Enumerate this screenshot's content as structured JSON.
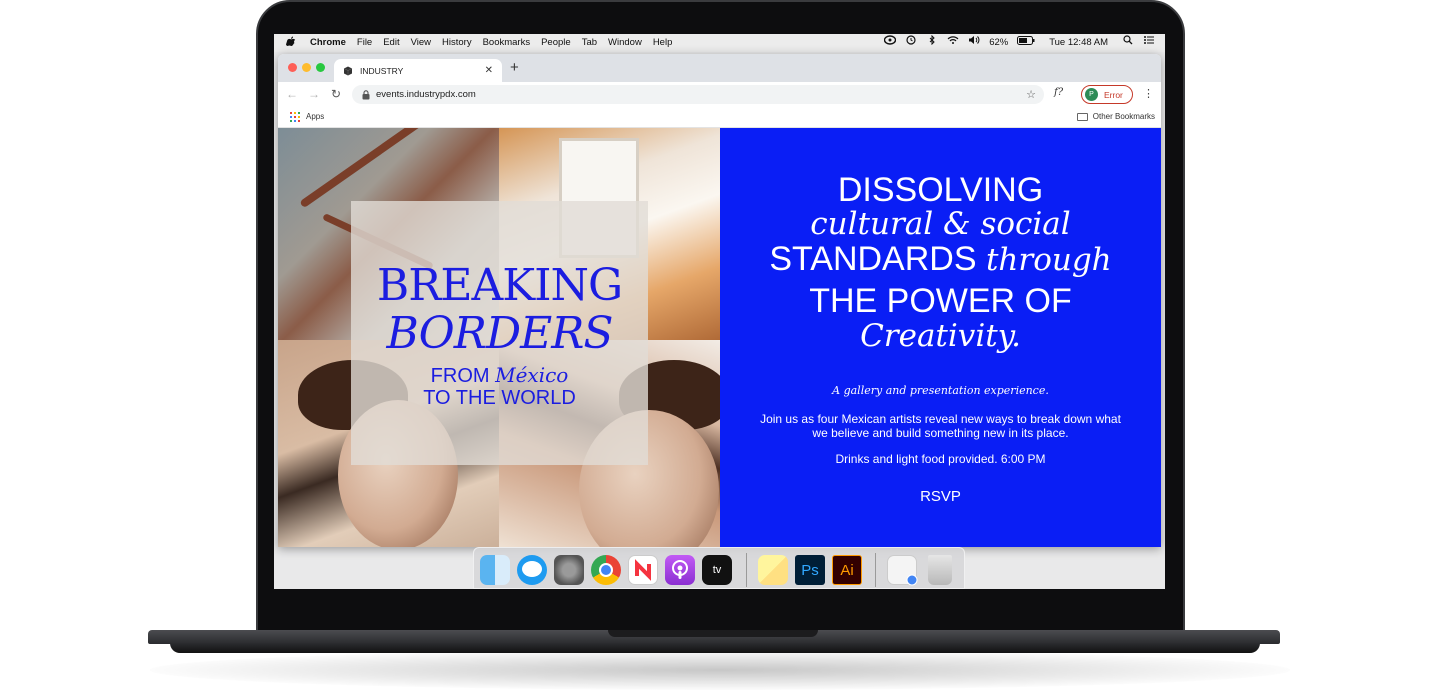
{
  "menubar": {
    "app_name": "Chrome",
    "menus": [
      "File",
      "Edit",
      "View",
      "History",
      "Bookmarks",
      "People",
      "Tab",
      "Window",
      "Help"
    ],
    "battery": "62%",
    "clock": "Tue 12:48 AM"
  },
  "browser": {
    "tab_title": "INDUSTRY",
    "url": "events.industrypdx.com",
    "extension_label": "f?",
    "profile_initial": "P",
    "profile_status": "Error",
    "bookmarks": {
      "apps": "Apps",
      "other": "Other Bookmarks"
    }
  },
  "page": {
    "poster": {
      "line1": "BREAKING",
      "line2": "BORDERS",
      "line3_a": "FROM ",
      "line3_b": "México",
      "line4": "TO THE WORLD"
    },
    "headline": {
      "l1": "DISSOLVING",
      "l2": "cultural & social",
      "l3_a": "STANDARDS ",
      "l3_b": "through",
      "l4": "THE POWER OF",
      "l5": "Creativity."
    },
    "tagline": "A gallery and presentation experience.",
    "description": "Join us as four Mexican artists reveal new ways to break down what we believe and build something new in its place.",
    "details": "Drinks and light food provided. 6:00 PM",
    "rsvp": "RSVP",
    "accent_color": "#0a1ef5"
  },
  "dock": {
    "apps": [
      "finder-icon",
      "messages-icon",
      "system-preferences-icon",
      "chrome-icon",
      "news-icon",
      "podcasts-icon",
      "apple-tv-icon",
      "stickies-icon",
      "photoshop-icon",
      "illustrator-icon",
      "downloads-icon",
      "trash-icon"
    ],
    "apple_tv_label": "tv",
    "photoshop_label": "Ps",
    "illustrator_label": "Ai"
  }
}
